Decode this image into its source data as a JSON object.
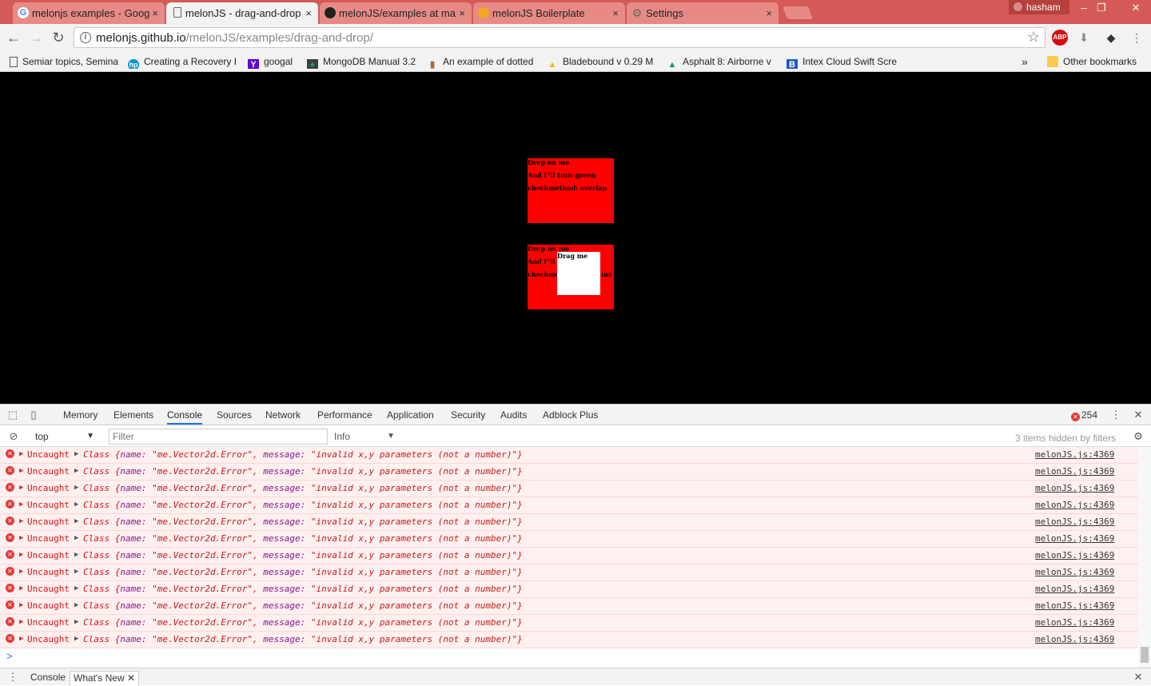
{
  "browser": {
    "tabs": [
      {
        "title": "melonjs examples - Goog",
        "icon": "google-icon"
      },
      {
        "title": "melonJS - drag-and-drop",
        "icon": "document-icon"
      },
      {
        "title": "melonJS/examples at ma",
        "icon": "github-icon"
      },
      {
        "title": "melonJS Boilerplate",
        "icon": "melonjs-icon"
      },
      {
        "title": "Settings",
        "icon": "gear-icon"
      }
    ],
    "active_tab": 1,
    "profile_name": "hasham",
    "close_symbol": "×",
    "address": {
      "host": "melonjs.github.io",
      "path": "/melonJS/examples/drag-and-drop/"
    },
    "extensions": {
      "abp": "ABP"
    }
  },
  "bookmarks": [
    {
      "label": "Semiar topics, Semina",
      "icon": "page-icon"
    },
    {
      "label": "Creating a Recovery I",
      "icon": "hp-icon"
    },
    {
      "label": "googal",
      "icon": "yahoo-icon"
    },
    {
      "label": "MongoDB Manual 3.2",
      "icon": "mongodb-icon"
    },
    {
      "label": "An example of dotted",
      "icon": "chart-icon"
    },
    {
      "label": "Bladebound v 0.29 M",
      "icon": "drive-icon"
    },
    {
      "label": "Asphalt 8: Airborne v",
      "icon": "drive-icon"
    },
    {
      "label": "Intex Cloud Swift Scre",
      "icon": "blogger-icon"
    }
  ],
  "bookmarks_overflow": "»",
  "other_bookmarks": "Other bookmarks",
  "page": {
    "box1": {
      "lines": [
        "Drop on me",
        "And I\"ll turn green",
        "checkmethod: overlap"
      ]
    },
    "box2": {
      "lines": [
        "Drop on me",
        "And I\"ll",
        "checkme",
        "ins"
      ]
    },
    "drag_label": "Drag me"
  },
  "devtools": {
    "tabs": [
      "Memory",
      "Elements",
      "Console",
      "Sources",
      "Network",
      "Performance",
      "Application",
      "Security",
      "Audits",
      "Adblock Plus"
    ],
    "active_tab": "Console",
    "error_count": "254",
    "context": "top",
    "filter_placeholder": "Filter",
    "level": "Info",
    "hidden_note": "3 items hidden by filters",
    "error_rows": [
      {
        "prefix": "Uncaught",
        "class": "Class",
        "name_key": "name:",
        "name_val": "\"me.Vector2d.Error\"",
        "msg_key": "message:",
        "msg_val": "\"invalid x,y parameters (not a number)\"",
        "source": "melonJS.js:4369"
      },
      {
        "prefix": "Uncaught",
        "class": "Class",
        "name_key": "name:",
        "name_val": "\"me.Vector2d.Error\"",
        "msg_key": "message:",
        "msg_val": "\"invalid x,y parameters (not a number)\"",
        "source": "melonJS.js:4369"
      },
      {
        "prefix": "Uncaught",
        "class": "Class",
        "name_key": "name:",
        "name_val": "\"me.Vector2d.Error\"",
        "msg_key": "message:",
        "msg_val": "\"invalid x,y parameters (not a number)\"",
        "source": "melonJS.js:4369"
      },
      {
        "prefix": "Uncaught",
        "class": "Class",
        "name_key": "name:",
        "name_val": "\"me.Vector2d.Error\"",
        "msg_key": "message:",
        "msg_val": "\"invalid x,y parameters (not a number)\"",
        "source": "melonJS.js:4369"
      },
      {
        "prefix": "Uncaught",
        "class": "Class",
        "name_key": "name:",
        "name_val": "\"me.Vector2d.Error\"",
        "msg_key": "message:",
        "msg_val": "\"invalid x,y parameters (not a number)\"",
        "source": "melonJS.js:4369"
      },
      {
        "prefix": "Uncaught",
        "class": "Class",
        "name_key": "name:",
        "name_val": "\"me.Vector2d.Error\"",
        "msg_key": "message:",
        "msg_val": "\"invalid x,y parameters (not a number)\"",
        "source": "melonJS.js:4369"
      },
      {
        "prefix": "Uncaught",
        "class": "Class",
        "name_key": "name:",
        "name_val": "\"me.Vector2d.Error\"",
        "msg_key": "message:",
        "msg_val": "\"invalid x,y parameters (not a number)\"",
        "source": "melonJS.js:4369"
      },
      {
        "prefix": "Uncaught",
        "class": "Class",
        "name_key": "name:",
        "name_val": "\"me.Vector2d.Error\"",
        "msg_key": "message:",
        "msg_val": "\"invalid x,y parameters (not a number)\"",
        "source": "melonJS.js:4369"
      },
      {
        "prefix": "Uncaught",
        "class": "Class",
        "name_key": "name:",
        "name_val": "\"me.Vector2d.Error\"",
        "msg_key": "message:",
        "msg_val": "\"invalid x,y parameters (not a number)\"",
        "source": "melonJS.js:4369"
      },
      {
        "prefix": "Uncaught",
        "class": "Class",
        "name_key": "name:",
        "name_val": "\"me.Vector2d.Error\"",
        "msg_key": "message:",
        "msg_val": "\"invalid x,y parameters (not a number)\"",
        "source": "melonJS.js:4369"
      },
      {
        "prefix": "Uncaught",
        "class": "Class",
        "name_key": "name:",
        "name_val": "\"me.Vector2d.Error\"",
        "msg_key": "message:",
        "msg_val": "\"invalid x,y parameters (not a number)\"",
        "source": "melonJS.js:4369"
      },
      {
        "prefix": "Uncaught",
        "class": "Class",
        "name_key": "name:",
        "name_val": "\"me.Vector2d.Error\"",
        "msg_key": "message:",
        "msg_val": "\"invalid x,y parameters (not a number)\"",
        "source": "melonJS.js:4369"
      }
    ],
    "drawer_tabs": [
      "Console",
      "What's New"
    ]
  },
  "colors": {
    "tabstrip": "#d35a56",
    "page_background": "#000000",
    "drop_box": "#ff0000",
    "drag_box": "#ffffff",
    "error_row_bg": "#fff0f0",
    "error_text": "#d11111"
  }
}
